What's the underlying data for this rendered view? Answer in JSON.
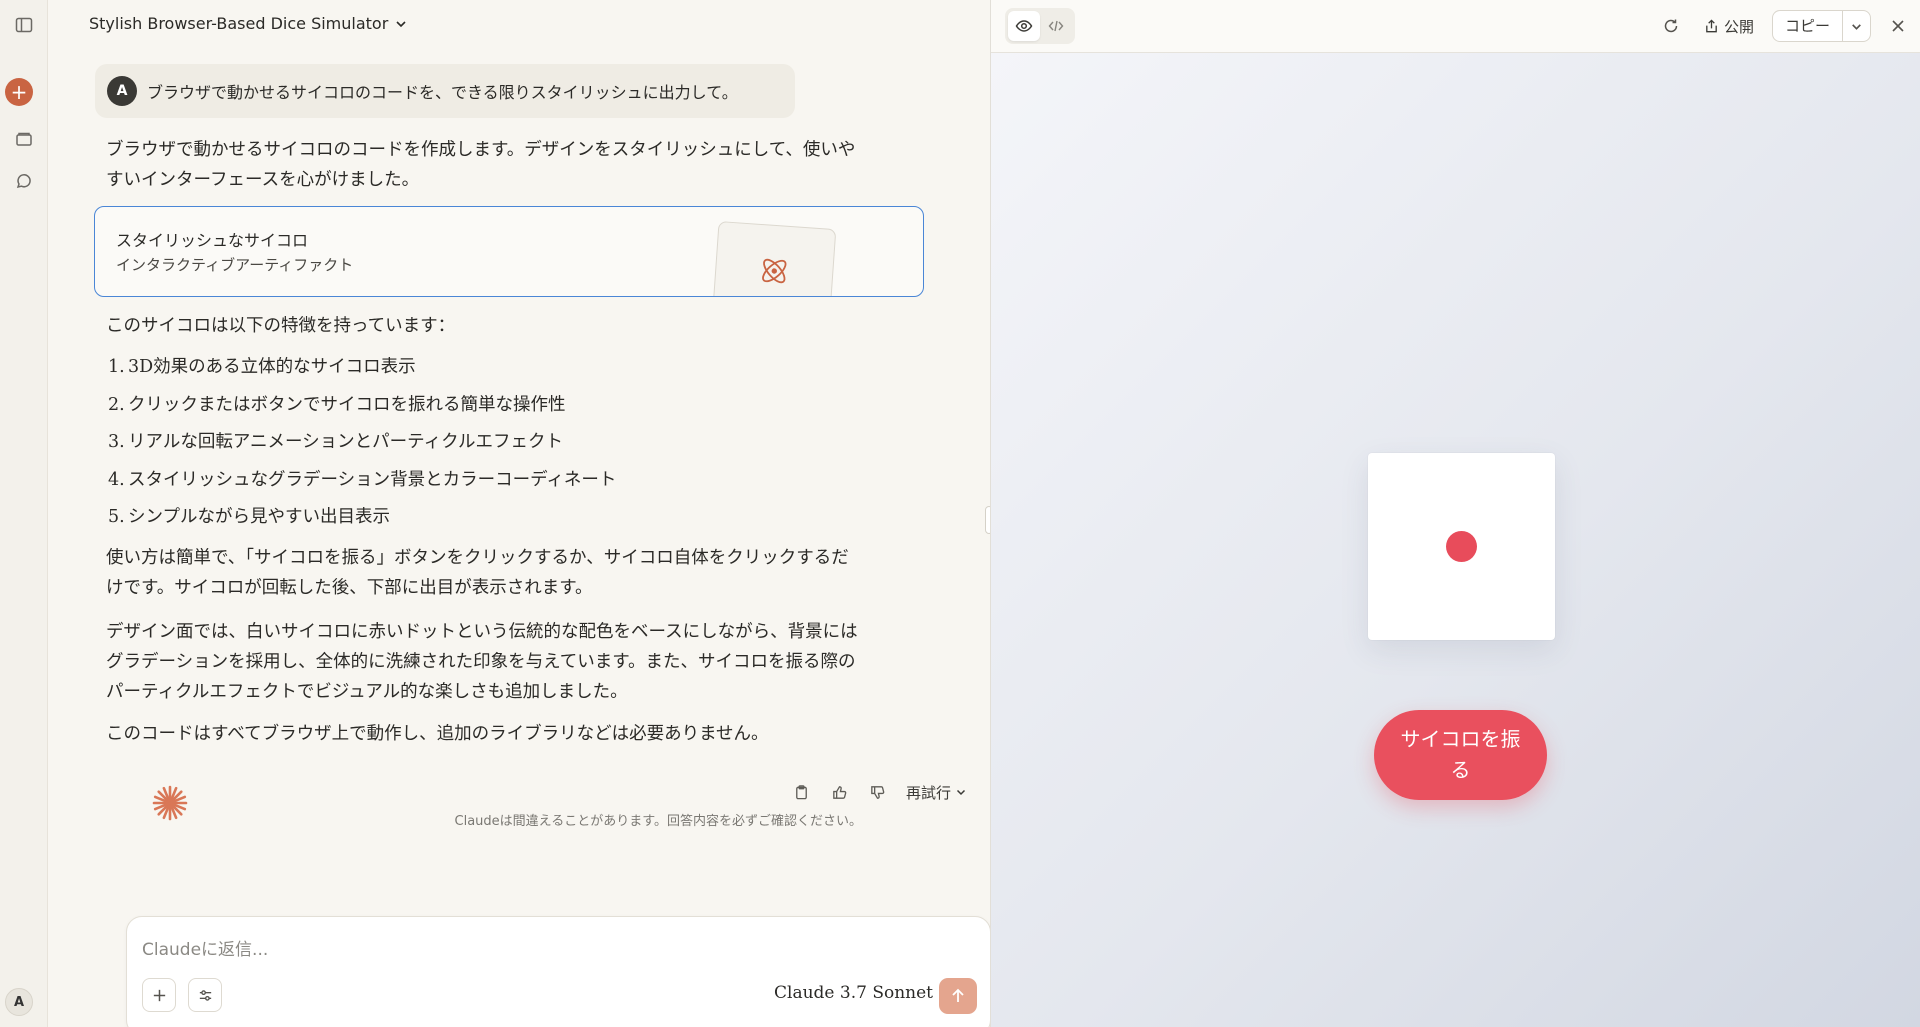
{
  "chat": {
    "title": "Stylish Browser-Based Dice Simulator",
    "user_avatar": "A",
    "user_message": "ブラウザで動かせるサイコロのコードを、できる限りスタイリッシュに出力して。",
    "intro_lines": [
      "ブラウザで動かせるサイコロのコードを作成します。デザインをスタイリッシュにして、使いや",
      "すいインターフェースを心がけました。"
    ],
    "artifact_card": {
      "title": "スタイリッシュなサイコロ",
      "subtitle": "インタラクティブアーティファクト",
      "icon": "atom-icon"
    },
    "features_heading": "このサイコロは以下の特徴を持っています：",
    "features": [
      {
        "num": "1.",
        "text": "3D効果のある立体的なサイコロ表示"
      },
      {
        "num": "2.",
        "text": "クリックまたはボタンでサイコロを振れる簡単な操作性"
      },
      {
        "num": "3.",
        "text": "リアルな回転アニメーションとパーティクルエフェクト"
      },
      {
        "num": "4.",
        "text": "スタイリッシュなグラデーション背景とカラーコーディネート"
      },
      {
        "num": "5.",
        "text": "シンプルながら見やすい出目表示"
      }
    ],
    "usage_lines": [
      "使い方は簡単で、「サイコロを振る」ボタンをクリックするか、サイコロ自体をクリックするだ",
      "けです。サイコロが回転した後、下部に出目が表示されます。"
    ],
    "design_lines": [
      "デザイン面では、白いサイコロに赤いドットという伝統的な配色をベースにしながら、背景には",
      "グラデーションを採用し、全体的に洗練された印象を与えています。また、サイコロを振る際の",
      "パーティクルエフェクトでビジュアル的な楽しさも追加しました。"
    ],
    "closing_line": "このコードはすべてブラウザ上で動作し、追加のライブラリなどは必要ありません。",
    "actions": {
      "retry_label": "再試行"
    },
    "disclaimer": "Claudeは間違えることがあります。回答内容を必ずご確認ください。"
  },
  "composer": {
    "placeholder": "Claudeに返信...",
    "model": "Claude 3.7 Sonnet"
  },
  "rail": {
    "user_initial": "A"
  },
  "artifact": {
    "publish_label": "公開",
    "copy_label": "コピー",
    "roll_button_label": "サイコロを振る",
    "die_value": 1,
    "colors": {
      "pip": "#e84c5b",
      "button": "#e9505e",
      "accent": "#c96442"
    }
  }
}
